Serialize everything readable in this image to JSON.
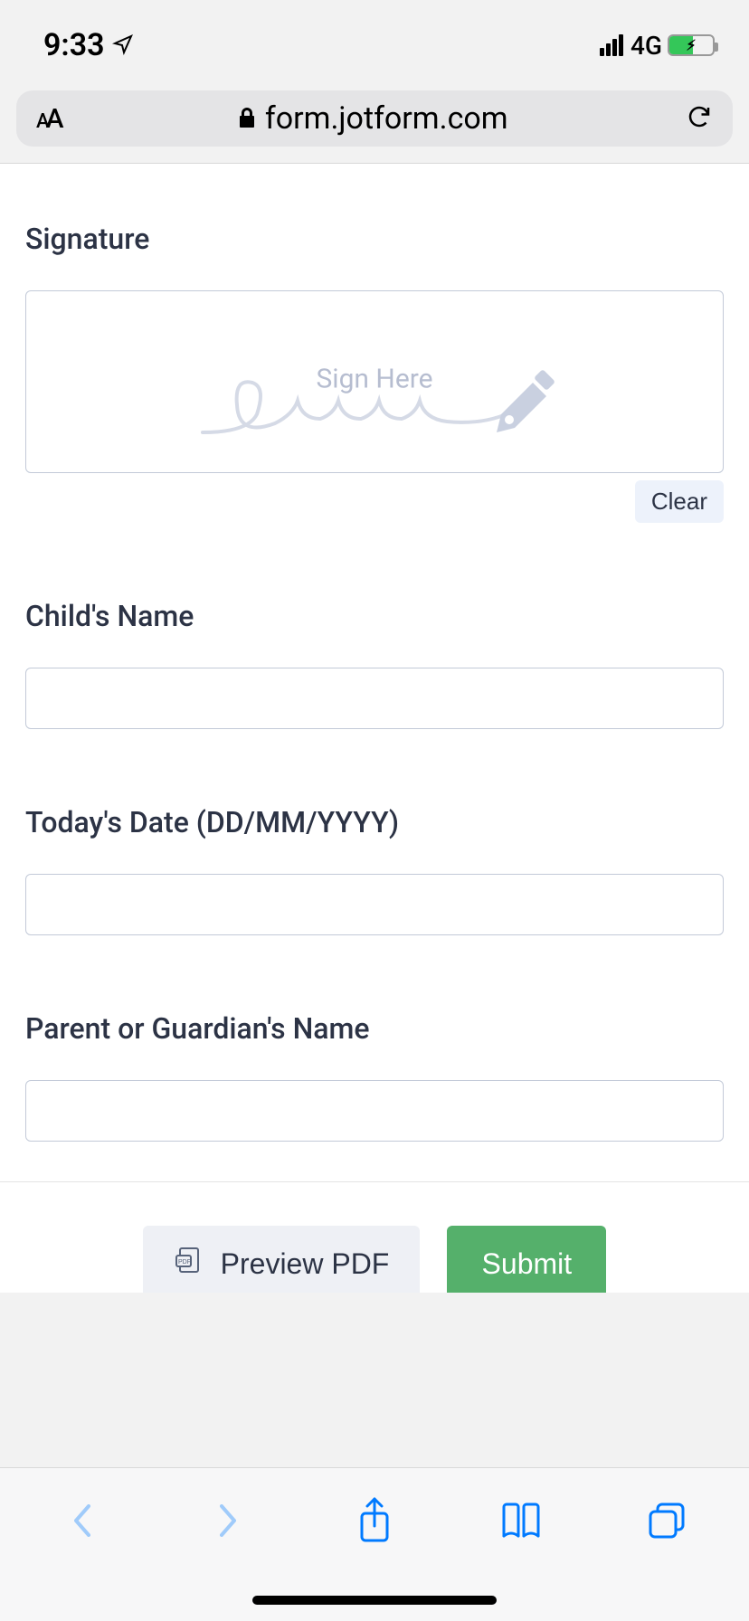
{
  "status": {
    "time": "9:33",
    "network": "4G"
  },
  "address_bar": {
    "domain": "form.jotform.com"
  },
  "form": {
    "signature": {
      "label": "Signature",
      "placeholder": "Sign Here",
      "clear_label": "Clear"
    },
    "child_name": {
      "label": "Child's Name",
      "value": ""
    },
    "date": {
      "label": "Today's Date (DD/MM/YYYY)",
      "value": ""
    },
    "guardian": {
      "label": "Parent or Guardian's Name",
      "value": ""
    }
  },
  "actions": {
    "preview": "Preview PDF",
    "submit": "Submit"
  }
}
